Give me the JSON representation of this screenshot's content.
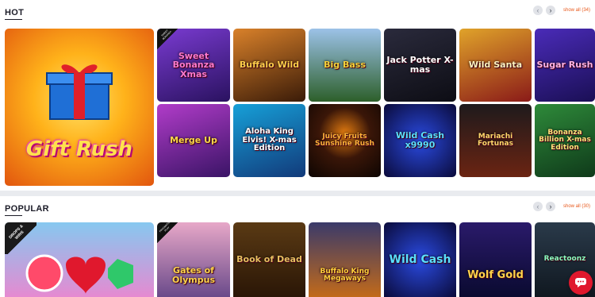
{
  "hot": {
    "title": "HOT",
    "show_all": "show all (34)",
    "prev_icon": "chevron-left-icon",
    "next_icon": "chevron-right-icon",
    "featured": {
      "name": "Gift Rush",
      "colors": [
        "#ffb21a",
        "#e2560e"
      ]
    },
    "tiles": [
      {
        "name": "Sweet Bonanza Xmas",
        "colors": [
          "#7a3bd1",
          "#2a1260"
        ],
        "badge": "SWEET BONANZA"
      },
      {
        "name": "Buffalo Wild",
        "colors": [
          "#d9812a",
          "#3a1b08"
        ]
      },
      {
        "name": "Big Bass",
        "colors": [
          "#9cc2e8",
          "#2d5f2a"
        ]
      },
      {
        "name": "Jack Potter X-mas",
        "colors": [
          "#1e1e2c",
          "#0d0d14"
        ]
      },
      {
        "name": "Wild Santa",
        "colors": [
          "#e0a32a",
          "#8a1a18"
        ]
      },
      {
        "name": "Sugar Rush",
        "colors": [
          "#4a2bb8",
          "#1a0f55"
        ]
      },
      {
        "name": "Merge Up",
        "colors": [
          "#b13cc9",
          "#3a1466"
        ]
      },
      {
        "name": "Aloha King Elvis! X-mas Edition",
        "colors": [
          "#16a0d8",
          "#123a7a"
        ]
      },
      {
        "name": "Juicy Fruits Sunshine Rush",
        "colors": [
          "#3a1608",
          "#0d0502"
        ]
      },
      {
        "name": "Wild Cash x9990",
        "colors": [
          "#1a2ca8",
          "#0a0a3a"
        ]
      },
      {
        "name": "Mariachi Fortunas",
        "colors": [
          "#1e1a1c",
          "#6b2412"
        ]
      },
      {
        "name": "Bonanza Billion X-mas Edition",
        "colors": [
          "#2e8a3a",
          "#0f3a1a"
        ]
      }
    ]
  },
  "popular": {
    "title": "POPULAR",
    "show_all": "show all (30)",
    "prev_icon": "chevron-left-icon",
    "next_icon": "chevron-right-icon",
    "featured": {
      "name": "Drops & Wins",
      "badge": "DROPS & WINS",
      "colors": [
        "#86c8f0",
        "#e58ad1"
      ]
    },
    "tiles": [
      {
        "name": "Gates of Olympus",
        "colors": [
          "#e7a8c8",
          "#6a4a8a"
        ],
        "badge": "PRAGMATIC PLAY"
      },
      {
        "name": "Book of Dead",
        "colors": [
          "#5a3a14",
          "#2a1606"
        ]
      },
      {
        "name": "Buffalo King Megaways",
        "colors": [
          "#3a3a6a",
          "#c26a1a"
        ]
      },
      {
        "name": "Wild Cash",
        "colors": [
          "#1a2ca8",
          "#0a0a3a"
        ]
      },
      {
        "name": "Wolf Gold",
        "colors": [
          "#2a1a6a",
          "#0a0a30"
        ]
      },
      {
        "name": "Reactoonz",
        "colors": [
          "#2a3a4a",
          "#101820"
        ]
      }
    ]
  },
  "chat": {
    "icon": "chat-bubble-icon",
    "color": "#e0182d"
  }
}
